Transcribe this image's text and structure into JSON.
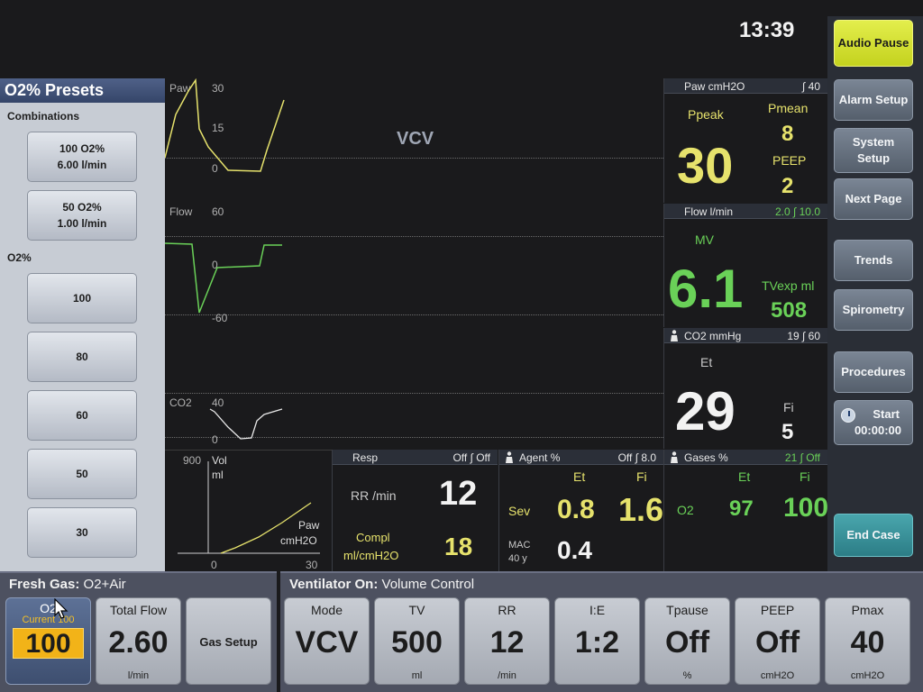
{
  "clock": "13:39",
  "right_buttons": {
    "audio_pause": "Audio Pause",
    "alarm_setup": "Alarm Setup",
    "system_setup_1": "System",
    "system_setup_2": "Setup",
    "next_page": "Next Page",
    "trends": "Trends",
    "spirometry": "Spirometry",
    "procedures": "Procedures",
    "start": "Start",
    "timer": "00:00:00",
    "end_case": "End Case"
  },
  "presets": {
    "title": "O2% Presets",
    "combinations_label": "Combinations",
    "combo": [
      {
        "line1": "100 O2%",
        "line2": "6.00 l/min"
      },
      {
        "line1": "50 O2%",
        "line2": "1.00 l/min"
      }
    ],
    "o2_label": "O2%",
    "o2_values": [
      "100",
      "80",
      "60",
      "50",
      "30"
    ]
  },
  "waveforms": {
    "mode_label": "VCV",
    "paw": {
      "label": "Paw",
      "ticks": [
        "30",
        "15",
        "0"
      ]
    },
    "flow": {
      "label": "Flow",
      "ticks": [
        "60",
        "0",
        "-60"
      ]
    },
    "co2": {
      "label": "CO2",
      "ticks": [
        "40",
        "0"
      ]
    }
  },
  "loop": {
    "ymax": "900",
    "ylabel1": "Vol",
    "ylabel2": "ml",
    "xlabel1": "Paw",
    "xlabel2": "cmH2O",
    "xmin": "0",
    "xmax": "30"
  },
  "paw_panel": {
    "title": "Paw cmH2O",
    "limits": "∫ 40",
    "ppeak_label": "Ppeak",
    "ppeak": "30",
    "pmean_label": "Pmean",
    "pmean": "8",
    "peep_label": "PEEP",
    "peep": "2"
  },
  "flow_panel": {
    "title": "Flow l/min",
    "limits": "2.0 ∫ 10.0",
    "mv_label": "MV",
    "mv": "6.1",
    "tvexp_label": "TVexp ml",
    "tvexp": "508"
  },
  "co2_panel": {
    "title": "CO2 mmHg",
    "limits": "19 ∫ 60",
    "et_label": "Et",
    "et": "29",
    "fi_label": "Fi",
    "fi": "5"
  },
  "resp_panel": {
    "title": "Resp",
    "limits": "Off ∫ Off",
    "rr_label": "RR /min",
    "rr": "12",
    "compl_label1": "Compl",
    "compl_label2": "ml/cmH2O",
    "compl": "18"
  },
  "agent_panel": {
    "title": "Agent %",
    "limits": "Off ∫ 8.0",
    "et_label": "Et",
    "fi_label": "Fi",
    "agent_name": "Sev",
    "et": "0.8",
    "fi": "1.6",
    "mac_label1": "MAC",
    "mac_label2": "40 y",
    "mac": "0.4"
  },
  "gases_panel": {
    "title": "Gases %",
    "limits": "21 ∫ Off",
    "et_label": "Et",
    "fi_label": "Fi",
    "gas_name": "O2",
    "et": "97",
    "fi": "100"
  },
  "fresh_gas": {
    "title": "Fresh Gas:",
    "subtitle": "O2+Air",
    "o2_label": "O2",
    "o2_current": "Current 100",
    "o2_value": "100",
    "total_flow_label": "Total Flow",
    "total_flow_value": "2.60",
    "total_flow_unit": "l/min",
    "gas_setup": "Gas Setup"
  },
  "ventilator": {
    "title": "Ventilator On:",
    "subtitle": "Volume Control",
    "settings": [
      {
        "label": "Mode",
        "value": "VCV",
        "unit": ""
      },
      {
        "label": "TV",
        "value": "500",
        "unit": "ml"
      },
      {
        "label": "RR",
        "value": "12",
        "unit": "/min"
      },
      {
        "label": "I:E",
        "value": "1:2",
        "unit": ""
      },
      {
        "label": "Tpause",
        "value": "Off",
        "unit": "%"
      },
      {
        "label": "PEEP",
        "value": "Off",
        "unit": "cmH2O"
      },
      {
        "label": "Pmax",
        "value": "40",
        "unit": "cmH2O"
      }
    ]
  },
  "colors": {
    "paw_wave": "#e6e26c",
    "flow_wave": "#6ad158",
    "co2_wave": "#e8e8e8",
    "accent_yellow": "#d4e02c",
    "accent_teal": "#3a95a0"
  }
}
